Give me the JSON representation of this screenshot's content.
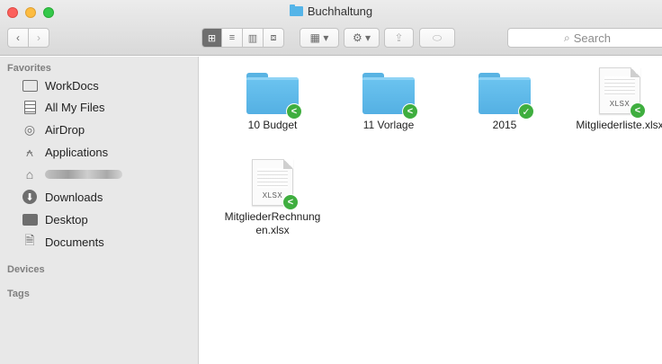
{
  "window": {
    "title": "Buchhaltung"
  },
  "toolbar": {
    "back_icon": "chevron-left-icon",
    "back_glyph": "‹",
    "forward_glyph": "›",
    "view_glyphs": [
      "⊞",
      "≡",
      "▥",
      "⧈"
    ],
    "arrange_glyph": "▦ ▾",
    "action_glyph": "⚙ ▾",
    "share_glyph": "⇪",
    "tag_glyph": "⬭",
    "search_placeholder": "Search",
    "search_glyph": "⌕"
  },
  "sidebar": {
    "favorites_header": "Favorites",
    "items": [
      {
        "label": "WorkDocs",
        "icon": "folder-outline-icon"
      },
      {
        "label": "All My Files",
        "icon": "all-files-icon"
      },
      {
        "label": "AirDrop",
        "icon": "airdrop-icon",
        "glyph": "◎"
      },
      {
        "label": "Applications",
        "icon": "applications-icon",
        "glyph": "⍲"
      },
      {
        "label": "",
        "icon": "home-icon",
        "glyph": "⌂",
        "redacted": true
      },
      {
        "label": "Downloads",
        "icon": "downloads-icon",
        "glyph": "⬇"
      },
      {
        "label": "Desktop",
        "icon": "desktop-icon"
      },
      {
        "label": "Documents",
        "icon": "documents-icon",
        "glyph": "🗎"
      }
    ],
    "devices_header": "Devices",
    "tags_header": "Tags"
  },
  "files": [
    {
      "name": "10 Budget",
      "kind": "folder",
      "badge": "shared"
    },
    {
      "name": "11 Vorlage",
      "kind": "folder",
      "badge": "shared"
    },
    {
      "name": "2015",
      "kind": "folder",
      "badge": "synced"
    },
    {
      "name": "Mitgliederliste.xlsx",
      "kind": "xlsx",
      "ext": "XLSX",
      "badge": "shared"
    },
    {
      "name": "MitgliederRechnungen.xlsx",
      "kind": "xlsx",
      "ext": "XLSX",
      "badge": "shared",
      "label_lines": [
        "MitgliederRechnung",
        "en.xlsx"
      ]
    }
  ],
  "badges": {
    "shared_glyph": "<",
    "synced_glyph": "✓",
    "color": "#3fae3f"
  },
  "colors": {
    "folder_blue": "#59b3e3",
    "sidebar_bg": "#e8e8e8",
    "close": "#fc605c",
    "minimize": "#fdbc40",
    "zoom": "#34c84a"
  }
}
